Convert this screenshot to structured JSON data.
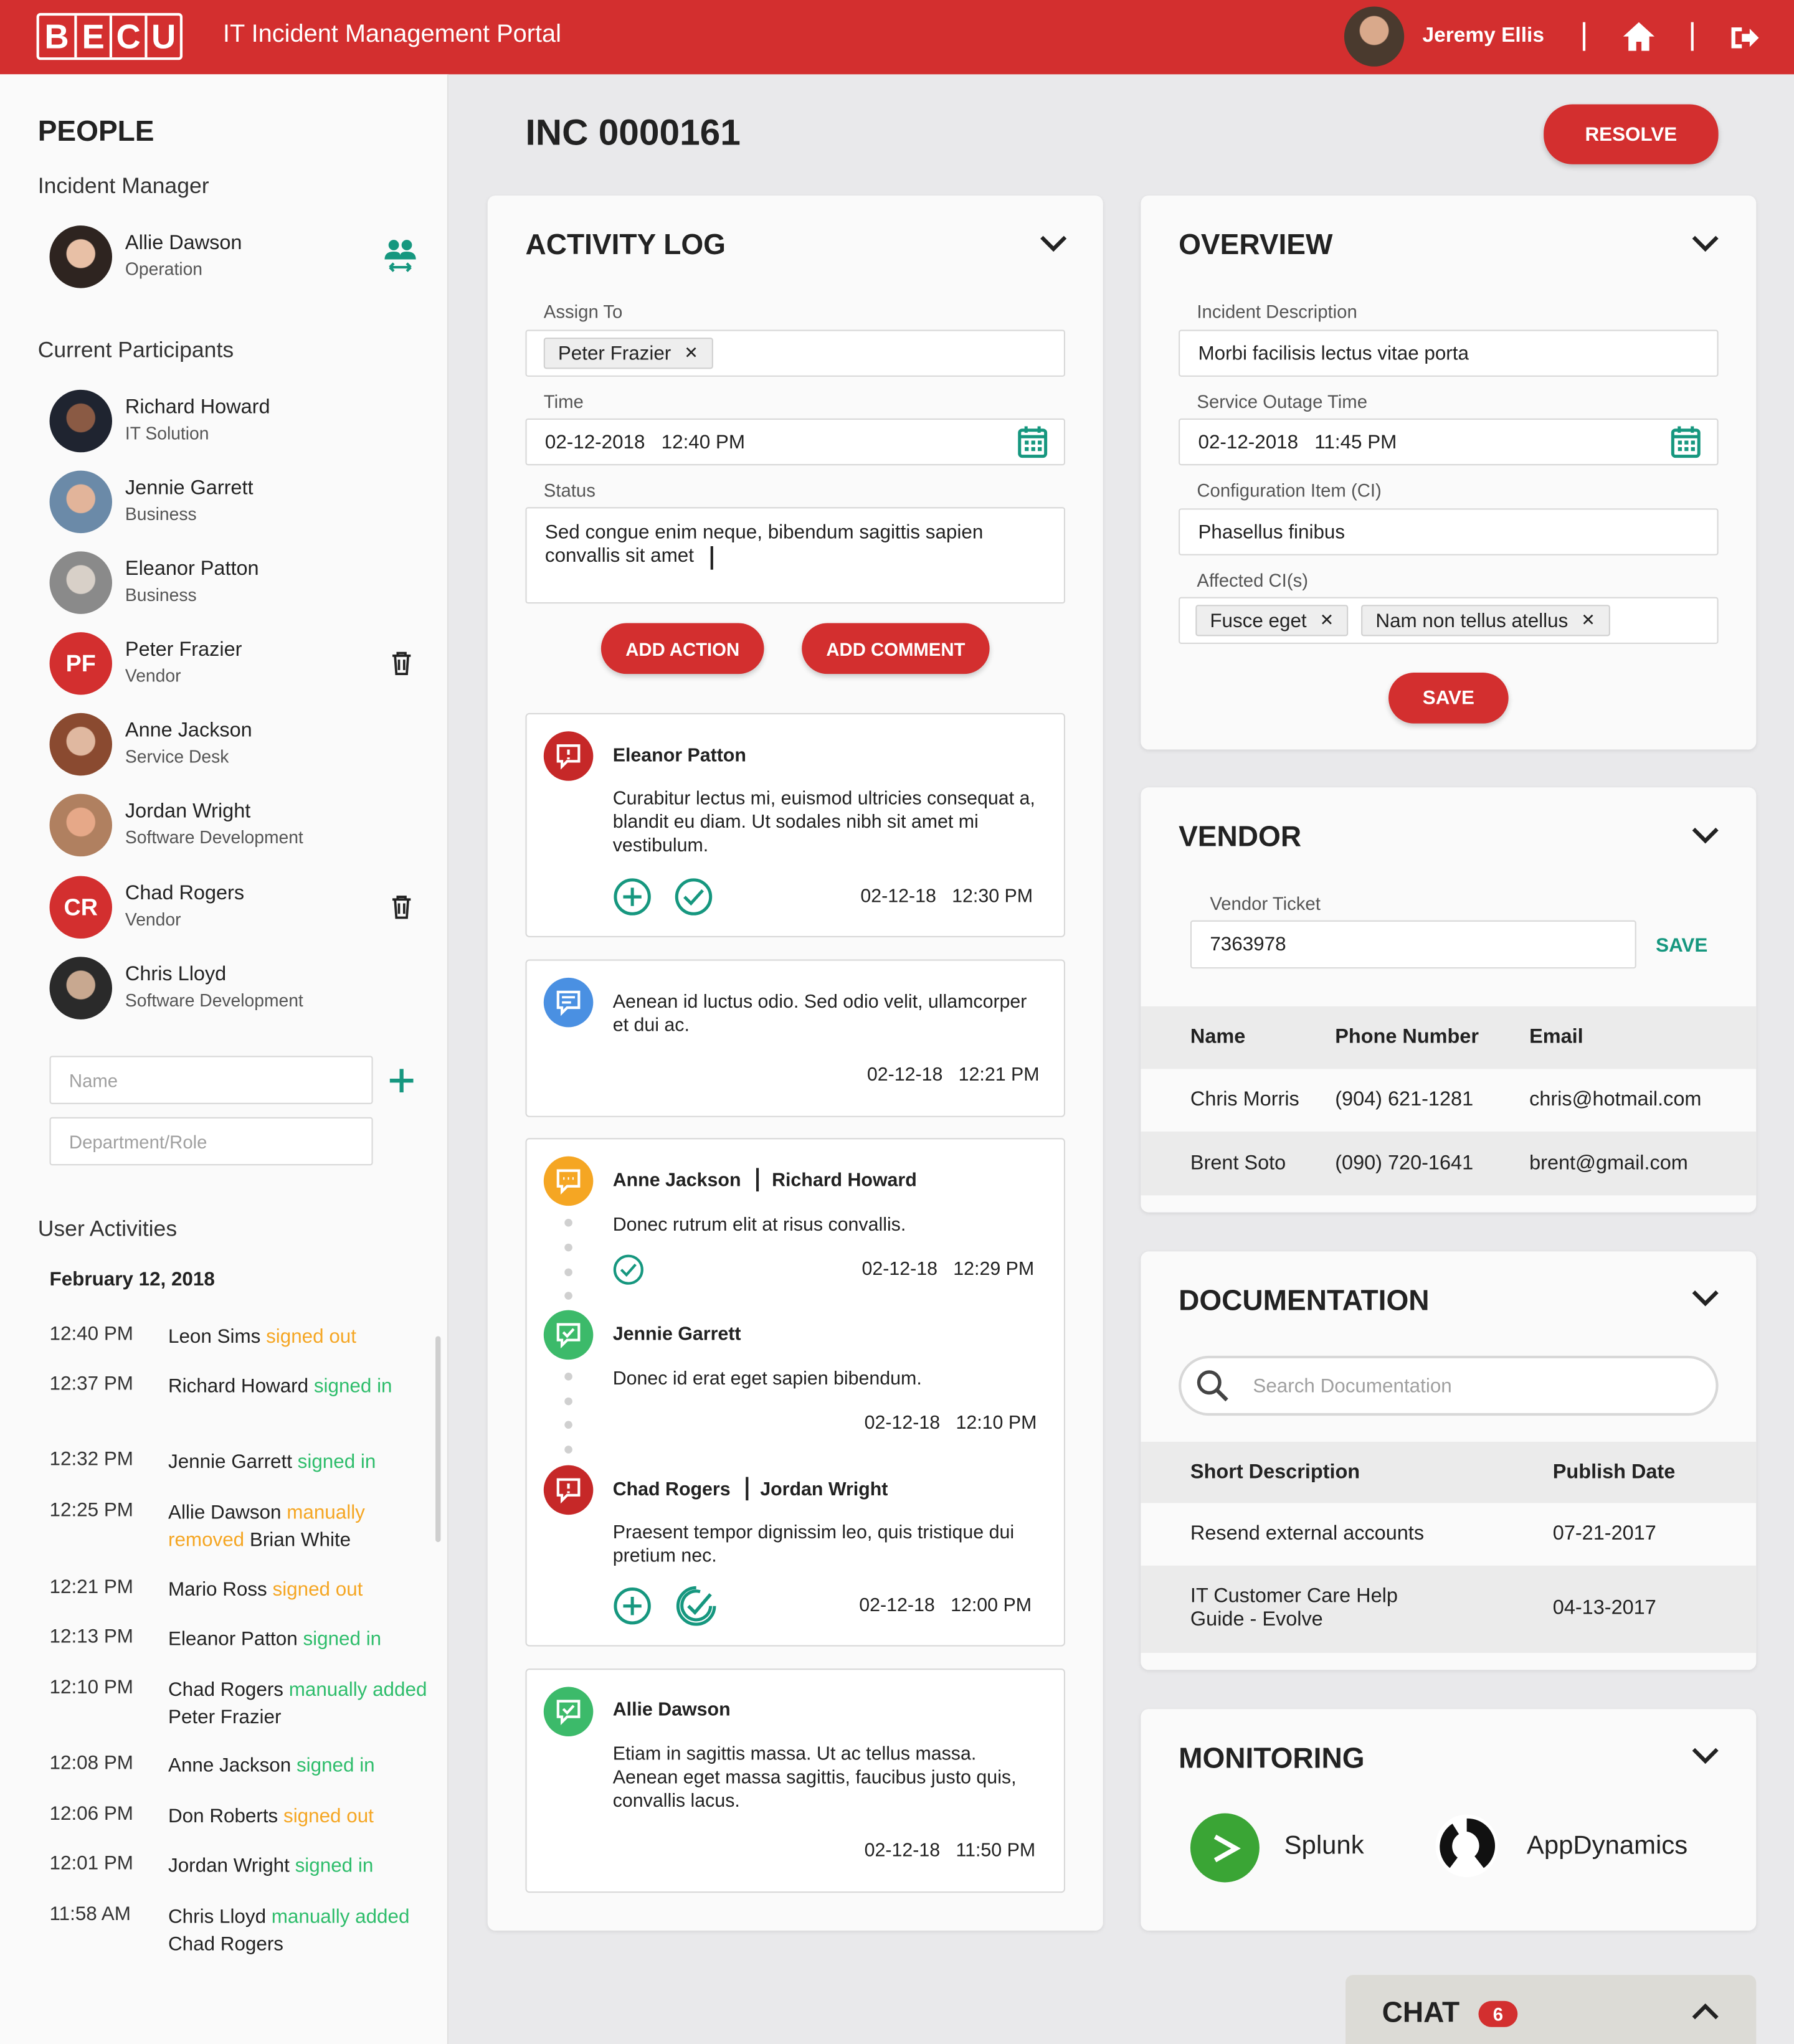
{
  "header": {
    "logo_letters": [
      "B",
      "E",
      "C",
      "U"
    ],
    "app_title": "IT Incident Management Portal",
    "user_name": "Jeremy Ellis",
    "brand_color": "#d32f2f"
  },
  "sidebar": {
    "title": "PEOPLE",
    "incident_manager_label": "Incident Manager",
    "incident_manager": {
      "name": "Allie Dawson",
      "role": "Operation"
    },
    "participants_label": "Current Participants",
    "participants": [
      {
        "name": "Richard Howard",
        "role": "IT Solution",
        "initials": ""
      },
      {
        "name": "Jennie Garrett",
        "role": "Business",
        "initials": ""
      },
      {
        "name": "Eleanor Patton",
        "role": "Business",
        "initials": ""
      },
      {
        "name": "Peter Frazier",
        "role": "Vendor",
        "initials": "PF"
      },
      {
        "name": "Anne Jackson",
        "role": "Service Desk",
        "initials": ""
      },
      {
        "name": "Jordan Wright",
        "role": "Software Development",
        "initials": ""
      },
      {
        "name": "Chad Rogers",
        "role": "Vendor",
        "initials": "CR"
      },
      {
        "name": "Chris Lloyd",
        "role": "Software Development",
        "initials": ""
      }
    ],
    "name_placeholder": "Name",
    "dept_placeholder": "Department/Role",
    "activities_label": "User Activities",
    "activities_date": "February 12, 2018",
    "activities": [
      {
        "time": "12:40 PM",
        "parts": [
          [
            "Leon Sims",
            ""
          ],
          [
            "signed out",
            "orange"
          ]
        ]
      },
      {
        "time": "12:37 PM",
        "parts": [
          [
            "Richard Howard",
            ""
          ],
          [
            "signed in",
            "green"
          ]
        ]
      },
      {
        "time": "12:32 PM",
        "parts": [
          [
            "Jennie Garrett",
            ""
          ],
          [
            "signed in",
            "green"
          ]
        ]
      },
      {
        "time": "12:25 PM",
        "parts": [
          [
            "Allie Dawson",
            ""
          ],
          [
            "manually removed",
            "orange"
          ],
          [
            "Brian White",
            ""
          ]
        ]
      },
      {
        "time": "12:21 PM",
        "parts": [
          [
            "Mario Ross",
            ""
          ],
          [
            "signed out",
            "orange"
          ]
        ]
      },
      {
        "time": "12:13 PM",
        "parts": [
          [
            "Eleanor Patton",
            ""
          ],
          [
            "signed in",
            "green"
          ]
        ]
      },
      {
        "time": "12:10 PM",
        "parts": [
          [
            "Chad Rogers",
            ""
          ],
          [
            "manually added",
            "green"
          ],
          [
            "Peter Frazier",
            ""
          ]
        ]
      },
      {
        "time": "12:08 PM",
        "parts": [
          [
            "Anne Jackson",
            ""
          ],
          [
            "signed in",
            "green"
          ]
        ]
      },
      {
        "time": "12:06 PM",
        "parts": [
          [
            "Don Roberts",
            ""
          ],
          [
            "signed out",
            "orange"
          ]
        ]
      },
      {
        "time": "12:01 PM",
        "parts": [
          [
            "Jordan Wright",
            ""
          ],
          [
            "signed in",
            "green"
          ]
        ]
      },
      {
        "time": "11:58 AM",
        "parts": [
          [
            "Chris Lloyd",
            ""
          ],
          [
            "manually added",
            "green"
          ],
          [
            "Chad Rogers",
            ""
          ]
        ]
      }
    ]
  },
  "incident": {
    "id": "INC 0000161",
    "resolve_label": "RESOLVE"
  },
  "activity_log": {
    "title": "ACTIVITY LOG",
    "assign_label": "Assign To",
    "assign_chip": "Peter Frazier",
    "time_label": "Time",
    "time_value": "02-12-2018   12:40 PM",
    "status_label": "Status",
    "status_value": "Sed congue enim neque, bibendum sagittis sapien convallis sit amet",
    "add_action_label": "ADD ACTION",
    "add_comment_label": "ADD COMMENT",
    "entries": {
      "e1": {
        "name": "Eleanor Patton",
        "text": "Curabitur lectus mi, euismod ultricies consequat a, blandit eu diam. Ut sodales nibh sit amet mi vestibulum.",
        "time": "02-12-18   12:30 PM"
      },
      "e2": {
        "text": "Aenean id luctus odio. Sed odio velit, ullamcorper et dui ac.",
        "time": "02-12-18   12:21 PM"
      },
      "e3a": {
        "name1": "Anne Jackson",
        "name2": "Richard Howard",
        "text": "Donec rutrum elit at risus convallis.",
        "time": "02-12-18   12:29 PM"
      },
      "e3b": {
        "name": "Jennie Garrett",
        "text": "Donec id erat eget sapien bibendum.",
        "time": "02-12-18   12:10 PM"
      },
      "e3c": {
        "name1": "Chad Rogers",
        "name2": "Jordan Wright",
        "text": "Praesent tempor dignissim leo, quis tristique dui pretium nec.",
        "time": "02-12-18   12:00 PM"
      },
      "e4": {
        "name": "Allie Dawson",
        "text": "Etiam in sagittis massa. Ut ac tellus massa. Aenean eget massa sagittis, faucibus justo quis, convallis lacus.",
        "time": "02-12-18   11:50 PM"
      }
    },
    "colors": {
      "red": "#c62828",
      "blue": "#4a90e2",
      "orange": "#f5a623",
      "green": "#3cba6a",
      "teal": "#16977f"
    }
  },
  "overview": {
    "title": "OVERVIEW",
    "desc_label": "Incident Description",
    "desc_value": "Morbi facilisis lectus vitae porta",
    "outage_label": "Service Outage Time",
    "outage_value": "02-12-2018   11:45 PM",
    "ci_label": "Configuration Item (CI)",
    "ci_value": "Phasellus finibus",
    "affected_label": "Affected CI(s)",
    "affected_chips": [
      "Fusce eget",
      "Nam non tellus atellus"
    ],
    "save_label": "SAVE"
  },
  "vendor": {
    "title": "VENDOR",
    "ticket_label": "Vendor Ticket",
    "ticket_value": "7363978",
    "save_label": "SAVE",
    "columns": [
      "Name",
      "Phone Number",
      "Email"
    ],
    "rows": [
      [
        "Chris Morris",
        "(904) 621-1281",
        "chris@hotmail.com"
      ],
      [
        "Brent Soto",
        "(090) 720-1641",
        "brent@gmail.com"
      ]
    ]
  },
  "documentation": {
    "title": "DOCUMENTATION",
    "search_placeholder": "Search Documentation",
    "columns": [
      "Short Description",
      "Publish Date"
    ],
    "rows": [
      [
        "Resend external accounts",
        "07-21-2017"
      ],
      [
        "IT Customer Care Help Guide - Evolve",
        "04-13-2017"
      ]
    ]
  },
  "monitoring": {
    "title": "MONITORING",
    "tools": [
      "Splunk",
      "AppDynamics"
    ]
  },
  "chat": {
    "label": "CHAT",
    "count": "6"
  }
}
